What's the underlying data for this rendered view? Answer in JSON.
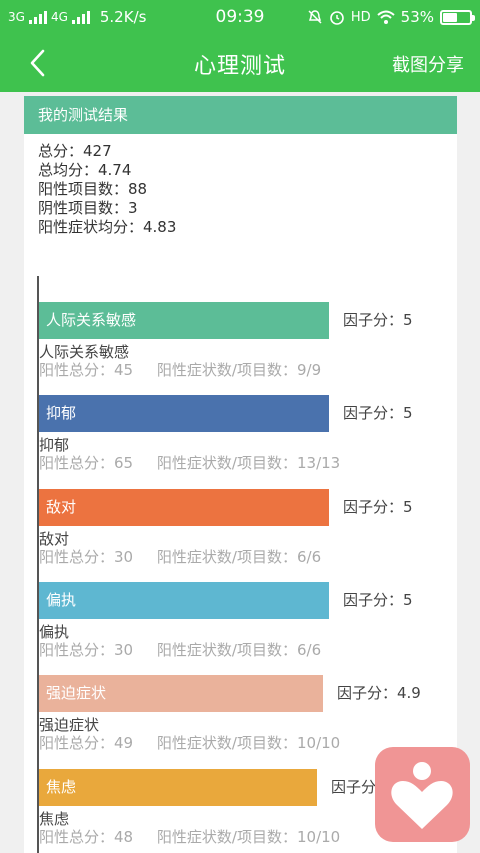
{
  "statusbar": {
    "net1": "3G",
    "net2": "4G",
    "speed": "5.2K/s",
    "time": "09:39",
    "icons": [
      "mute-icon",
      "alarm-icon",
      "wifi-icon"
    ],
    "hd": "HD",
    "battery": "53%",
    "battery_level": 0.53
  },
  "navbar": {
    "title": "心理测试",
    "share": "截图分享"
  },
  "result": {
    "heading": "我的测试结果",
    "total": "总分：427",
    "average": "总均分：4.74",
    "positive_items": "阳性项目数：88",
    "negative_items": "阴性项目数：3",
    "positive_avg": "阳性症状均分：4.83"
  },
  "factors": [
    {
      "name": "人际关系敏感",
      "score_label": "因子分：5",
      "score": 5,
      "meta": "阳性总分：45     阳性症状数/项目数：9/9",
      "color": "#5cbd97"
    },
    {
      "name": "抑郁",
      "score_label": "因子分：5",
      "score": 5,
      "meta": "阳性总分：65     阳性症状数/项目数：13/13",
      "color": "#4a72ad"
    },
    {
      "name": "敌对",
      "score_label": "因子分：5",
      "score": 5,
      "meta": "阳性总分：30     阳性症状数/项目数：6/6",
      "color": "#ec7340"
    },
    {
      "name": "偏执",
      "score_label": "因子分：5",
      "score": 5,
      "meta": "阳性总分：30     阳性症状数/项目数：6/6",
      "color": "#5eb7d1"
    },
    {
      "name": "强迫症状",
      "score_label": "因子分：4.9",
      "score": 4.9,
      "meta": "阳性总分：49     阳性症状数/项目数：10/10",
      "color": "#eab29b"
    },
    {
      "name": "焦虑",
      "score_label": "因子分：4.8",
      "score": 4.8,
      "meta": "阳性总分：48     阳性症状数/项目数：10/10",
      "color": "#e9a83c"
    }
  ]
}
